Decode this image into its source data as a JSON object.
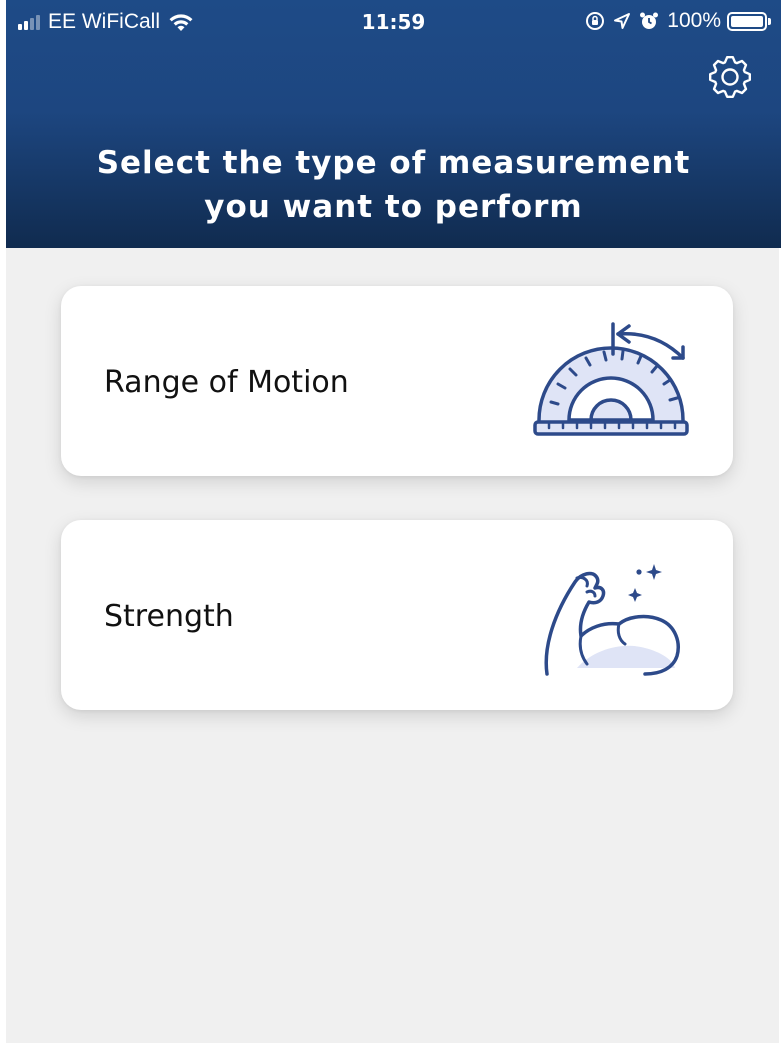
{
  "status_bar": {
    "carrier": "EE WiFiCall",
    "time": "11:59",
    "battery_percent": "100%",
    "battery_level": 1.0,
    "signal_bars_active": 2,
    "signal_bars_total": 4,
    "icons": [
      "signal-icon",
      "wifi-icon",
      "orientation-lock-icon",
      "location-arrow-icon",
      "alarm-icon",
      "battery-icon"
    ]
  },
  "header": {
    "title": "Select the type of measurement\nyou want to perform",
    "settings_icon": "gear-icon"
  },
  "options": [
    {
      "label": "Range of Motion",
      "icon": "protractor-icon"
    },
    {
      "label": "Strength",
      "icon": "flexed-arm-icon"
    }
  ],
  "colors": {
    "header_top": "#1e4b87",
    "header_bottom": "#102b4f",
    "background": "#f0f0f0",
    "card": "#ffffff",
    "icon_stroke": "#2d4a8a",
    "icon_fill": "#dfe4f6"
  }
}
